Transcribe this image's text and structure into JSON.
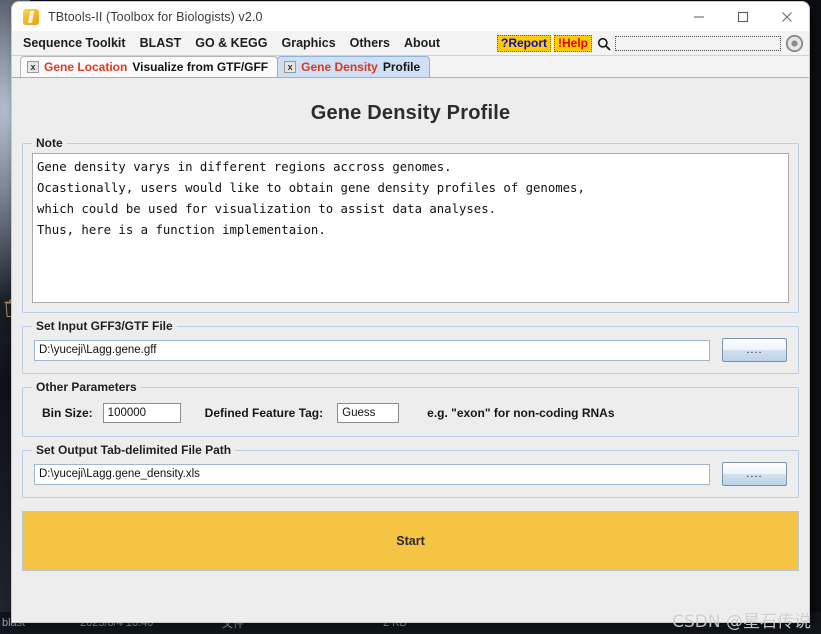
{
  "window": {
    "title": "TBtools-II (Toolbox for Biologists) v2.0",
    "logo_icon": "tbtools-logo-icon",
    "controls": [
      {
        "name": "minimize-button",
        "icon": "minimize-icon"
      },
      {
        "name": "maximize-button",
        "icon": "maximize-icon"
      },
      {
        "name": "close-button",
        "icon": "close-icon"
      }
    ]
  },
  "menubar": {
    "items": [
      {
        "label": "Sequence Toolkit"
      },
      {
        "label": "BLAST"
      },
      {
        "label": "GO & KEGG"
      },
      {
        "label": "Graphics"
      },
      {
        "label": "Others"
      },
      {
        "label": "About"
      }
    ],
    "report_label": "?Report",
    "help_label": "!Help",
    "search_icon": "search-icon",
    "search_value": "",
    "search_placeholder": "",
    "round_button_icon": "record-circle-icon"
  },
  "tabs": [
    {
      "close_glyph": "x",
      "highlight": "Gene Location",
      "rest": "Visualize from GTF/GFF",
      "active": false
    },
    {
      "close_glyph": "x",
      "highlight": "Gene Density",
      "rest": "Profile",
      "active": true
    }
  ],
  "page": {
    "title": "Gene Density Profile"
  },
  "note": {
    "group_title": "Note",
    "text": "Gene density varys in different regions accross genomes.\nOcastionally, users would like to obtain gene density profiles of genomes,\nwhich could be used for visualization to assist data analyses.\nThus, here is a function implementaion."
  },
  "input_file": {
    "group_title": "Set Input GFF3/GTF File",
    "value": "D:\\yuceji\\Lagg.gene.gff",
    "placeholder": "",
    "browse_label": "...."
  },
  "other_parameters": {
    "group_title": "Other Parameters",
    "bin_size_label": "Bin Size:",
    "bin_size_value": "100000",
    "feature_tag_label": "Defined Feature Tag:",
    "feature_tag_value": "Guess",
    "hint": "e.g. \"exon\" for non-coding RNAs"
  },
  "output_file": {
    "group_title": "Set Output Tab-delimited File Path",
    "value": "D:\\yuceji\\Lagg.gene_density.xls",
    "placeholder": "",
    "browse_label": "...."
  },
  "start": {
    "label": "Start"
  },
  "background": {
    "explorer_row": {
      "name": "blast",
      "date": "2023/6/4 18:40",
      "type": "文件",
      "size": "2 KB"
    },
    "desktop_icon": "recycle-bin-icon"
  },
  "watermark": {
    "text": "CSDN @星石传说"
  },
  "colors": {
    "accent_yellow": "#f5c442",
    "hot_yellow": "#ffcc00",
    "tab_active": "#cfe0f4",
    "panel": "#ededed",
    "group_border": "#b9cde4",
    "tab_red": "#e03b20",
    "report_blue": "#0a0ad0",
    "help_red": "#e00000"
  }
}
